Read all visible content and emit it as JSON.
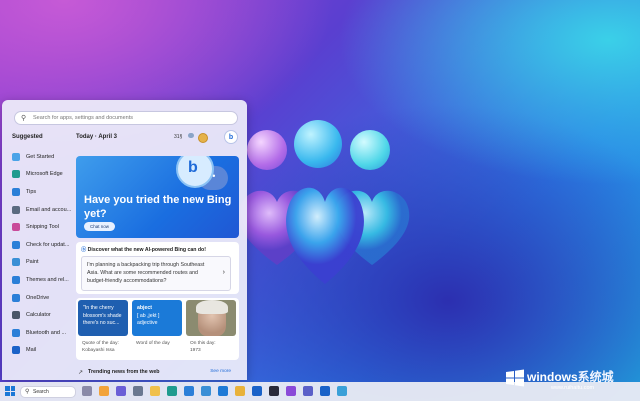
{
  "search": {
    "placeholder": "Search for apps, settings and documents"
  },
  "suggested": {
    "title": "Suggested",
    "items": [
      {
        "label": "Get Started",
        "icon": "get-started-icon",
        "color": "#4aa3e8"
      },
      {
        "label": "Microsoft Edge",
        "icon": "edge-icon",
        "color": "#1f9b8e"
      },
      {
        "label": "Tips",
        "icon": "tips-icon",
        "color": "#2b7fd8"
      },
      {
        "label": "Email and accou...",
        "icon": "email-icon",
        "color": "#5a6a80"
      },
      {
        "label": "Snipping Tool",
        "icon": "snipping-tool-icon",
        "color": "#c94a9a"
      },
      {
        "label": "Check for updat...",
        "icon": "update-icon",
        "color": "#2b7fd8"
      },
      {
        "label": "Paint",
        "icon": "paint-icon",
        "color": "#3a8fd6"
      },
      {
        "label": "Themes and rel...",
        "icon": "themes-icon",
        "color": "#2b7fd8"
      },
      {
        "label": "OneDrive",
        "icon": "onedrive-icon",
        "color": "#2b7fd8"
      },
      {
        "label": "Calculator",
        "icon": "calculator-icon",
        "color": "#4a5568"
      },
      {
        "label": "Bluetooth and ...",
        "icon": "bluetooth-icon",
        "color": "#2b7fd8"
      },
      {
        "label": "Mail",
        "icon": "mail-icon",
        "color": "#1a62c8"
      }
    ]
  },
  "widgets": {
    "today_label": "Today",
    "date": "April 3",
    "weather": "31§",
    "hero": {
      "title": "Have you tried the new Bing yet?",
      "button": "Chat now"
    },
    "discover": {
      "title": "Discover what the new AI-powered Bing can do!",
      "prompt": "I'm planning a backpacking trip through Southeast Asia. What are some recommended routes and budget-friendly accommodations?"
    },
    "tiles": [
      {
        "text1": "\"In the cherry",
        "text2": "blossom's shade",
        "text3": "there's no suc...",
        "cap1": "Quote of the day:",
        "cap2": "Kobayashi Issa"
      },
      {
        "text1": "abject",
        "text2": "[ ab ,jekt ]",
        "text3": "adjective",
        "cap1": "Word of the day",
        "cap2": ""
      },
      {
        "cap1": "On this day:",
        "cap2": "1973"
      }
    ],
    "news": {
      "title": "Trending news from the web",
      "more": "See more"
    }
  },
  "taskbar": {
    "search_label": "Search",
    "pinned_icons": [
      {
        "icon": "task-view-icon",
        "color": "#8a8aa8"
      },
      {
        "icon": "weather-icon",
        "color": "#f2a33a"
      },
      {
        "icon": "chat-icon",
        "color": "#6b5fd6"
      },
      {
        "icon": "settings-icon",
        "color": "#6a7890"
      },
      {
        "icon": "file-explorer-icon",
        "color": "#f0c04a"
      },
      {
        "icon": "edge-icon",
        "color": "#1f9b8e"
      },
      {
        "icon": "store-icon",
        "color": "#2b7fd8"
      },
      {
        "icon": "photos-icon",
        "color": "#3a8fd6"
      },
      {
        "icon": "vscode-icon",
        "color": "#1e7ad6"
      },
      {
        "icon": "chrome-icon",
        "color": "#e8b23a"
      },
      {
        "icon": "outlook-icon",
        "color": "#1a62c8"
      },
      {
        "icon": "terminal-icon",
        "color": "#2a2a3a"
      },
      {
        "icon": "clipchamp-icon",
        "color": "#8a4ad8"
      },
      {
        "icon": "teams-icon",
        "color": "#5a5fc8"
      },
      {
        "icon": "mail-icon",
        "color": "#1a62c8"
      },
      {
        "icon": "app-icon",
        "color": "#3aa0d8"
      }
    ]
  },
  "watermark": {
    "brand": "windows",
    "brand2": "系统城",
    "url": "www.ruihaitu.com"
  }
}
